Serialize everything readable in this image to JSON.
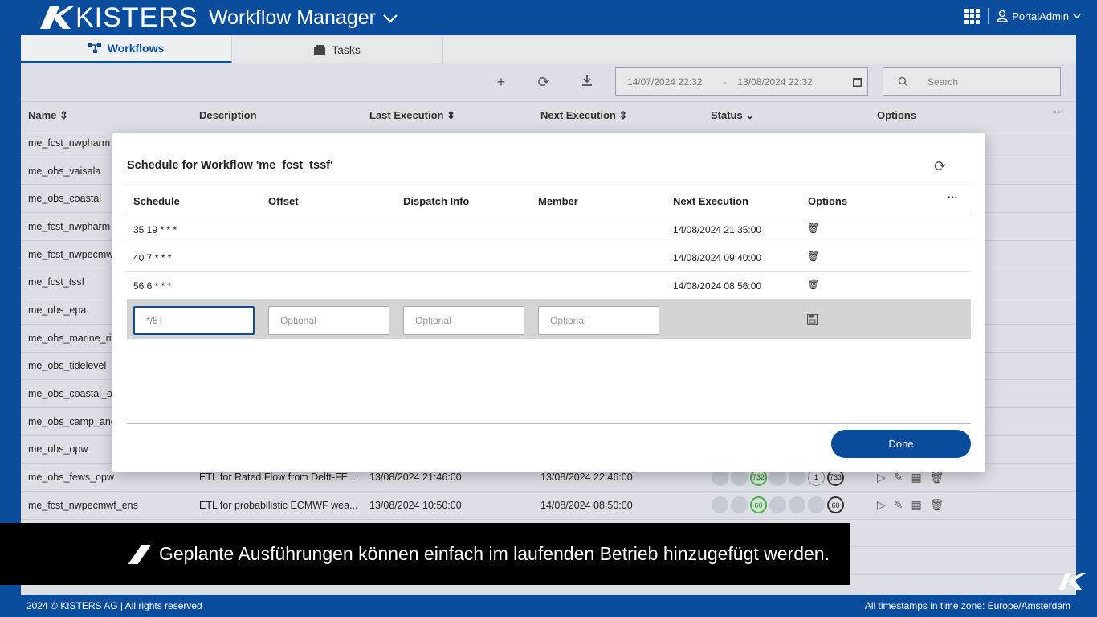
{
  "header": {
    "brand": "KISTERS",
    "app_title": "Workflow Manager",
    "user": "PortalAdmin"
  },
  "tabs": [
    {
      "label": "Workflows"
    },
    {
      "label": "Tasks"
    }
  ],
  "toolbar": {
    "date_from": "14/07/2024 22:32",
    "date_sep": "-",
    "date_to": "13/08/2024 22:32",
    "search_placeholder": "Search"
  },
  "table": {
    "columns": {
      "name": "Name",
      "description": "Description",
      "last_execution": "Last Execution",
      "next_execution": "Next Execution",
      "status": "Status",
      "options": "Options"
    },
    "rows": [
      {
        "name": "me_fcst_nwpharm",
        "description": "",
        "last": "",
        "next": ""
      },
      {
        "name": "me_obs_vaisala",
        "description": "",
        "last": "",
        "next": ""
      },
      {
        "name": "me_obs_coastal",
        "description": "",
        "last": "",
        "next": ""
      },
      {
        "name": "me_fcst_nwpharm",
        "description": "",
        "last": "",
        "next": ""
      },
      {
        "name": "me_fcst_nwpecmw",
        "description": "",
        "last": "",
        "next": ""
      },
      {
        "name": "me_fcst_tssf",
        "description": "",
        "last": "",
        "next": ""
      },
      {
        "name": "me_obs_epa",
        "description": "",
        "last": "",
        "next": ""
      },
      {
        "name": "me_obs_marine_ri",
        "description": "",
        "last": "",
        "next": ""
      },
      {
        "name": "me_obs_tidelevel",
        "description": "",
        "last": "",
        "next": ""
      },
      {
        "name": "me_obs_coastal_o",
        "description": "",
        "last": "",
        "next": ""
      },
      {
        "name": "me_obs_camp_and",
        "description": "",
        "last": "",
        "next": ""
      },
      {
        "name": "me_obs_opw",
        "description": "",
        "last": "",
        "next": ""
      },
      {
        "name": "me_obs_fews_opw",
        "description": "ETL for Rated Flow from Delft-FE...",
        "last": "13/08/2024 21:46:00",
        "next": "13/08/2024 22:46:00",
        "s_green": "732",
        "s_grey": "1",
        "s_total": "733"
      },
      {
        "name": "me_fcst_nwpecmwf_ens",
        "description": "ETL for probabilistic ECMWF wea...",
        "last": "13/08/2024 10:50:00",
        "next": "14/08/2024 08:50:00",
        "s_green": "60",
        "s_total": "60"
      }
    ]
  },
  "modal": {
    "title": "Schedule for Workflow 'me_fcst_tssf'",
    "columns": {
      "schedule": "Schedule",
      "offset": "Offset",
      "dispatch": "Dispatch Info",
      "member": "Member",
      "next": "Next Execution",
      "options": "Options"
    },
    "rows": [
      {
        "schedule": "35 19 * * *",
        "next": "14/08/2024 21:35:00"
      },
      {
        "schedule": "40 7 * * *",
        "next": "14/08/2024 09:40:00"
      },
      {
        "schedule": "56 6 * * *",
        "next": "14/08/2024 08:56:00"
      }
    ],
    "new_row": {
      "schedule_value": "*/5",
      "offset_placeholder": "Optional",
      "dispatch_placeholder": "Optional",
      "member_placeholder": "Optional"
    },
    "done_label": "Done"
  },
  "subtitle": "Geplante Ausführungen können einfach im laufenden Betrieb hinzugefügt werden.",
  "footer": {
    "copyright": "2024 © KISTERS AG | All rights reserved",
    "timezone": "All timestamps in time zone: Europe/Amsterdam"
  },
  "colors": {
    "brand_blue": "#0a4d9c",
    "status_green": "#4caf50"
  }
}
